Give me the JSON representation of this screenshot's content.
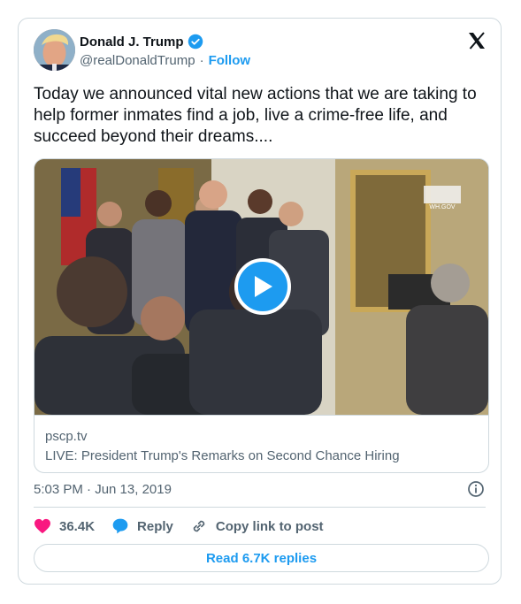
{
  "author": {
    "name": "Donald J. Trump",
    "handle": "@realDonaldTrump",
    "separator": "·",
    "follow_label": "Follow"
  },
  "tweet": {
    "text": "Today we announced vital new actions that we are taking to help former inmates find a job, live a crime-free life, and succeed beyond their dreams...."
  },
  "link_card": {
    "domain": "pscp.tv",
    "title": "LIVE: President Trump's Remarks on Second Chance Hiring",
    "watermark": "WH.GOV"
  },
  "meta": {
    "timestamp": "5:03 PM · Jun 13, 2019"
  },
  "actions": {
    "likes_count": "36.4K",
    "reply_label": "Reply",
    "copy_link_label": "Copy link to post"
  },
  "footer": {
    "read_replies_label": "Read 6.7K replies"
  },
  "colors": {
    "accent": "#1d9bf0",
    "like": "#f91880",
    "text": "#0f1419",
    "muted": "#536471",
    "border": "#cfd9de"
  },
  "icons": [
    "x-logo-icon",
    "verified-badge-icon",
    "play-icon",
    "info-icon",
    "heart-icon",
    "reply-bubble-icon",
    "link-icon"
  ]
}
